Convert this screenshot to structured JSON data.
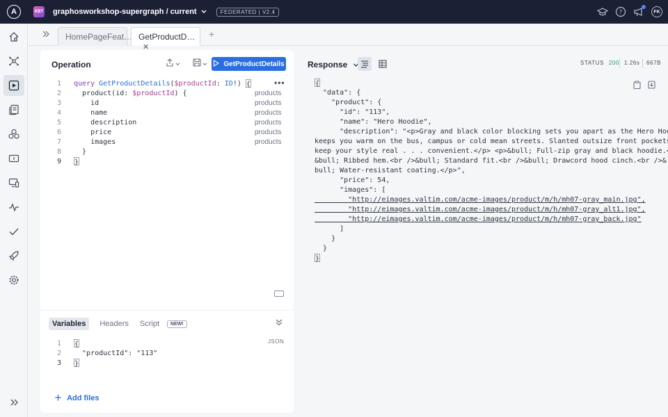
{
  "topbar": {
    "graph_badge": "KBT",
    "graph_name": "graphosworkshop-supergraph / current",
    "federation_badge": "FEDERATED | V2.4",
    "avatar_initials": "FK"
  },
  "tabs": [
    {
      "label": "HomePageFeat…"
    },
    {
      "label": "GetProductD…",
      "active": true
    }
  ],
  "operation": {
    "title": "Operation",
    "run_label": "GetProductDetails",
    "lines": [
      {
        "num": "1",
        "text": "query GetProductDetails($productId: ID!) {",
        "ann": ""
      },
      {
        "num": "2",
        "text": "  product(id: $productId) {",
        "ann": "products"
      },
      {
        "num": "3",
        "text": "    id",
        "ann": "products"
      },
      {
        "num": "4",
        "text": "    name",
        "ann": "products"
      },
      {
        "num": "5",
        "text": "    description",
        "ann": "products"
      },
      {
        "num": "6",
        "text": "    price",
        "ann": "products"
      },
      {
        "num": "7",
        "text": "    images",
        "ann": "products"
      },
      {
        "num": "8",
        "text": "  }",
        "ann": ""
      },
      {
        "num": "9",
        "text": "}",
        "ann": ""
      }
    ]
  },
  "variables": {
    "tabs": [
      "Variables",
      "Headers",
      "Script"
    ],
    "new_badge": "NEW!",
    "format_label": "JSON",
    "lines": [
      {
        "num": "1",
        "text": "{"
      },
      {
        "num": "2",
        "text": "  \"productId\": \"113\""
      },
      {
        "num": "3",
        "text": "}"
      }
    ],
    "add_files": "Add files"
  },
  "response": {
    "title": "Response",
    "status_label": "STATUS",
    "status_code": "200",
    "time": "1.26s",
    "size": "667B",
    "lines": [
      "{",
      "  \"data\": {",
      "    \"product\": {",
      "      \"id\": \"113\",",
      "      \"name\": \"Hero Hoodie\",",
      "      \"description\": \"<p>Gray and black color blocking sets you apart as the Hero Hoodie",
      "keeps you warm on the bus, campus or cold mean streets. Slanted outsize front pockets",
      "keep your style real . . . convenient.</p> <p>&bull; Full-zip gray and black hoodie.<br />",
      "&bull; Ribbed hem.<br />&bull; Standard fit.<br />&bull; Drawcord hood cinch.<br />&",
      "bull; Water-resistant coating.</p>\",",
      "      \"price\": 54,",
      "      \"images\": [",
      "        \"http://eimages.valtim.com/acme-images/product/m/h/mh07-gray_main.jpg\",",
      "        \"http://eimages.valtim.com/acme-images/product/m/h/mh07-gray_alt1.jpg\",",
      "        \"http://eimages.valtim.com/acme-images/product/m/h/mh07-gray_back.jpg\"",
      "      ]",
      "    }",
      "  }",
      "}"
    ]
  }
}
